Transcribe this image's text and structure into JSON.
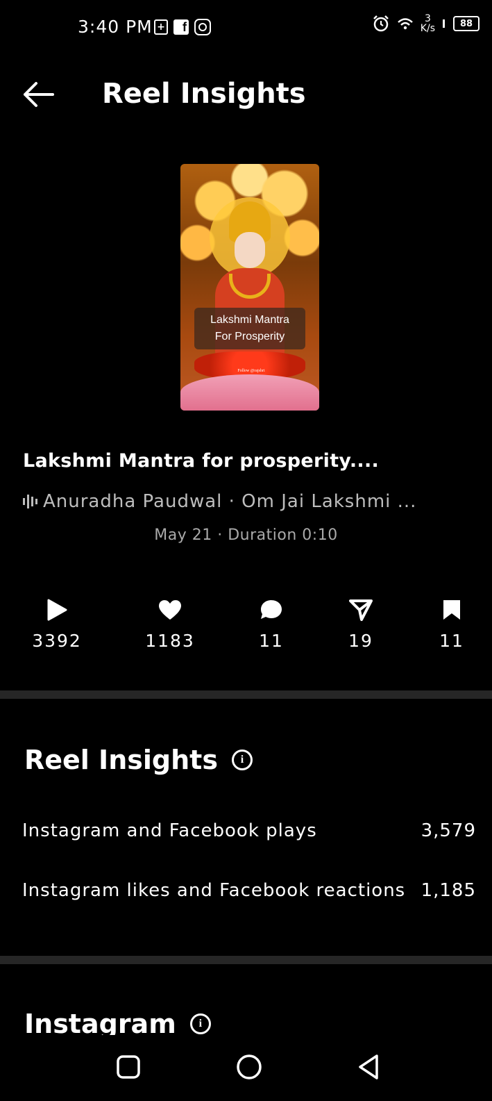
{
  "status_bar": {
    "time": "3:40 PM",
    "network_speed_value": "3",
    "network_speed_unit": "K/s",
    "battery": "88",
    "icons": [
      "battery-saver-icon",
      "facebook-icon",
      "instagram-icon",
      "alarm-icon",
      "wifi-icon",
      "signal-icon",
      "battery-icon"
    ]
  },
  "header": {
    "title": "Reel Insights"
  },
  "reel": {
    "thumbnail_caption_line1": "Lakshmi Mantra",
    "thumbnail_caption_line2": "For Prosperity",
    "thumbnail_follow_text": "Follow @rajshri",
    "title": "Lakshmi Mantra for prosperity....",
    "audio": "Anuradha Paudwal · Om Jai Lakshmi ...",
    "meta": "May 21 · Duration 0:10"
  },
  "stats": {
    "plays": "3392",
    "likes": "1183",
    "comments": "11",
    "shares": "19",
    "saves": "11"
  },
  "insights": {
    "title": "Reel Insights",
    "rows": [
      {
        "label": "Instagram and Facebook plays",
        "value": "3,579"
      },
      {
        "label": "Instagram likes and Facebook reactions",
        "value": "1,185"
      }
    ]
  },
  "instagram_section": {
    "title": "Instagram"
  },
  "colors": {
    "background": "#000000",
    "divider": "#262626",
    "secondary_text": "#aaaaaa"
  }
}
